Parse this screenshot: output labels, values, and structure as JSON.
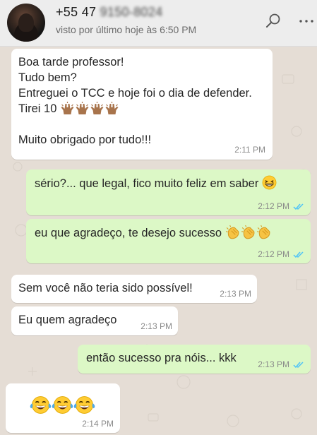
{
  "header": {
    "name_prefix": "+55 47",
    "name_masked": "9150-8024",
    "last_seen": "visto por último hoje às 6:50 PM",
    "icons": [
      "search-icon",
      "menu-icon"
    ]
  },
  "messages": [
    {
      "direction": "incoming",
      "lines": [
        "Boa tarde professor!",
        "Tudo bem?",
        "Entreguei o TCC e hoje foi o dia de defender.",
        "Tirei 10",
        "",
        "Muito obrigado por tudo!!!"
      ],
      "emoji_after_line_4": [
        "raising-hands-emoji",
        "raising-hands-emoji",
        "raising-hands-emoji",
        "raising-hands-emoji"
      ],
      "time": "2:11 PM"
    },
    {
      "direction": "outgoing",
      "text": "sério?... que legal, fico muito feliz em saber",
      "emoji": [
        "grinning-squinting-face-emoji"
      ],
      "time": "2:12 PM",
      "status": "read"
    },
    {
      "direction": "outgoing",
      "text": "eu que agradeço, te desejo sucesso",
      "emoji": [
        "clapping-hands-emoji",
        "clapping-hands-emoji",
        "clapping-hands-emoji"
      ],
      "time": "2:12 PM",
      "status": "read"
    },
    {
      "direction": "incoming",
      "text": "Sem você não teria sido possível!",
      "time": "2:13 PM"
    },
    {
      "direction": "incoming",
      "text": "Eu quem agradeço",
      "time": "2:13 PM"
    },
    {
      "direction": "outgoing",
      "text": "então sucesso pra nóis... kkk",
      "time": "2:13 PM",
      "status": "read"
    },
    {
      "direction": "incoming",
      "emoji": [
        "face-with-tears-of-joy-emoji",
        "face-with-tears-of-joy-emoji",
        "face-with-tears-of-joy-emoji"
      ],
      "time": "2:14 PM"
    }
  ],
  "colors": {
    "header_bg": "#ededed",
    "chat_bg": "#e5ddd5",
    "incoming_bubble": "#ffffff",
    "outgoing_bubble": "#dcf8c6",
    "read_ticks": "#4fc3f7"
  }
}
